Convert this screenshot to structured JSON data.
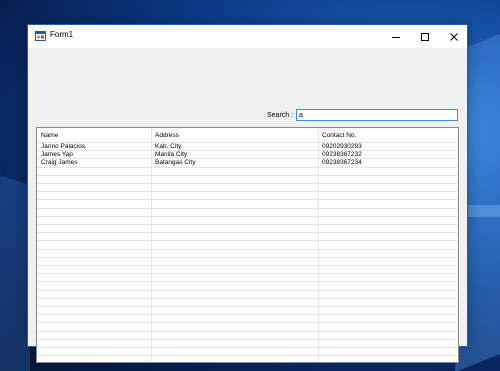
{
  "window": {
    "title": "Form1",
    "title_icon": "form-window-icon",
    "controls": [
      "minimize-icon",
      "maximize-icon",
      "close-icon"
    ]
  },
  "search": {
    "label": "Search :",
    "value": "a"
  },
  "table": {
    "columns": [
      "Name",
      "Address",
      "Contact No."
    ],
    "rows": [
      [
        "Janno Palacios",
        "Kab. City",
        "09202930293"
      ],
      [
        "James Yap",
        "Manila City",
        "09238367232"
      ],
      [
        "Craig James",
        "Batangas City",
        "09238367234"
      ]
    ]
  },
  "colors": {
    "accent_border": "#3c8ed6",
    "window_border": "#1c5fb0",
    "grid_line": "#e4e4e4"
  }
}
